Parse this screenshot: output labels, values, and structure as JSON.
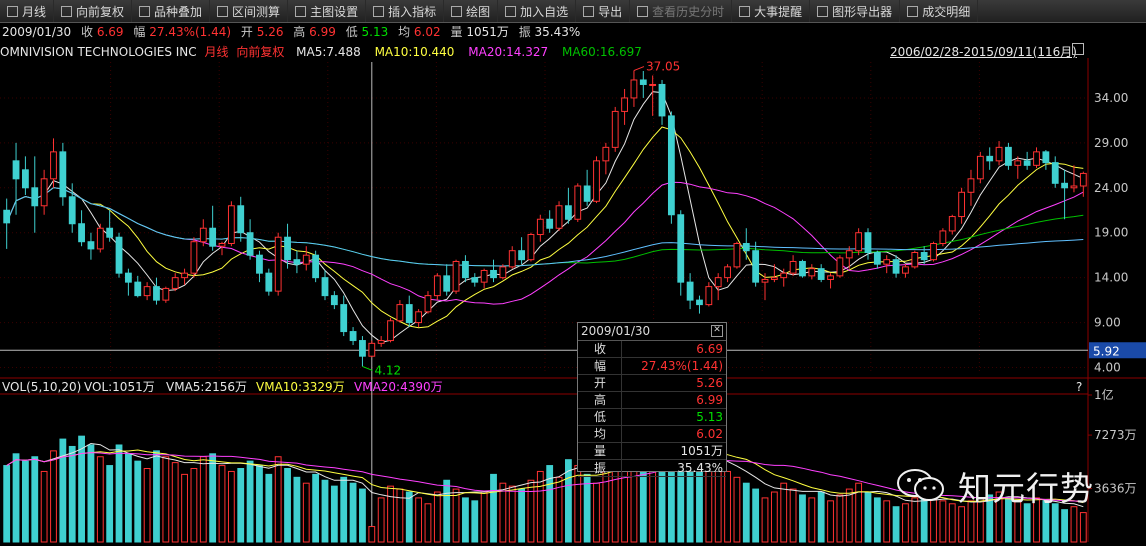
{
  "toolbar": [
    {
      "label": "月线",
      "icon": "period-icon",
      "enabled": true
    },
    {
      "label": "向前复权",
      "icon": "adjust-icon",
      "enabled": true
    },
    {
      "label": "品种叠加",
      "icon": "overlay-icon",
      "enabled": true
    },
    {
      "label": "区间测算",
      "icon": "range-icon",
      "enabled": true
    },
    {
      "label": "主图设置",
      "icon": "settings-icon",
      "enabled": true
    },
    {
      "label": "插入指标",
      "icon": "indicator-icon",
      "enabled": true
    },
    {
      "label": "绘图",
      "icon": "draw-icon",
      "enabled": true
    },
    {
      "label": "加入自选",
      "icon": "add-icon",
      "enabled": true
    },
    {
      "label": "导出",
      "icon": "export-icon",
      "enabled": true
    },
    {
      "label": "查看历史分时",
      "icon": "history-icon",
      "enabled": false
    },
    {
      "label": "大事提醒",
      "icon": "event-icon",
      "enabled": true
    },
    {
      "label": "图形导出器",
      "icon": "chart-export-icon",
      "enabled": true
    },
    {
      "label": "成交明细",
      "icon": "detail-icon",
      "enabled": true
    }
  ],
  "info": {
    "date": "2009/01/30",
    "close_label": "收",
    "close": "6.69",
    "change_label": "幅",
    "change": "27.43%(1.44)",
    "open_label": "开",
    "open": "5.26",
    "high_label": "高",
    "high": "6.99",
    "low_label": "低",
    "low": "5.13",
    "avg_label": "均",
    "avg": "6.02",
    "vol_label": "量",
    "vol": "1051万",
    "amp_label": "振",
    "amp": "35.43%"
  },
  "title": {
    "name": "OMNIVISION TECHNOLOGIES INC",
    "period": "月线",
    "adjust": "向前复权",
    "ma5": "MA5:7.488",
    "ma10": "MA10:10.440",
    "ma20": "MA20:14.327",
    "ma60": "MA60:16.697",
    "range": "2006/02/28-2015/09/11(116月)"
  },
  "price_axis": {
    "ticks": [
      "34.00",
      "29.00",
      "24.00",
      "19.00",
      "14.00",
      "9.00",
      "4.00"
    ],
    "crosshair": "5.92"
  },
  "annotations": {
    "high": "37.05",
    "low": "4.12"
  },
  "volume_title": {
    "name": "VOL(5,10,20)",
    "vol": "VOL:1051万",
    "vma5": "VMA5:2156万",
    "vma10": "VMA10:3329万",
    "vma20": "VMA20:4390万",
    "help": "?"
  },
  "volume_axis": {
    "top": "1亿",
    "mid": "7273万",
    "low": "3636万"
  },
  "popup": {
    "date": "2009/01/30",
    "close_btn": "✕",
    "rows": [
      {
        "k": "收",
        "v": "6.69",
        "c": "#ff3232"
      },
      {
        "k": "幅",
        "v": "27.43%(1.44)",
        "c": "#ff3232"
      },
      {
        "k": "开",
        "v": "5.26",
        "c": "#ff3232"
      },
      {
        "k": "高",
        "v": "6.99",
        "c": "#ff3232"
      },
      {
        "k": "低",
        "v": "5.13",
        "c": "#00e000"
      },
      {
        "k": "均",
        "v": "6.02",
        "c": "#ff3232"
      },
      {
        "k": "量",
        "v": "1051万",
        "c": "#e6e6e6"
      },
      {
        "k": "振",
        "v": "35.43%",
        "c": "#e6e6e6"
      }
    ]
  },
  "watermark": "知元行势",
  "colors": {
    "up": "#ff3232",
    "down": "#3fd0d0",
    "ma5": "#e6e6e6",
    "ma10": "#ffff40",
    "ma20": "#ff40ff",
    "ma60": "#00c000",
    "ma120": "#60c0ff"
  },
  "chart_data": {
    "type": "candlestick",
    "title": "OMNIVISION TECHNOLOGIES INC 月线",
    "ylim": [
      3.5,
      38
    ],
    "candles": [
      [
        21.5,
        22.8,
        17.2,
        20.1
      ],
      [
        27.0,
        29.0,
        21.0,
        25.0
      ],
      [
        26.0,
        27.5,
        23.2,
        24.0
      ],
      [
        24.0,
        27.5,
        19.0,
        22.0
      ],
      [
        22.0,
        26.0,
        21.0,
        25.0
      ],
      [
        25.0,
        29.5,
        24.0,
        28.0
      ],
      [
        28.0,
        29.0,
        22.0,
        23.0
      ],
      [
        23.0,
        24.5,
        19.0,
        20.0
      ],
      [
        20.0,
        21.5,
        17.5,
        18.0
      ],
      [
        18.0,
        19.0,
        16.0,
        17.2
      ],
      [
        17.2,
        20.0,
        16.8,
        19.5
      ],
      [
        19.5,
        21.5,
        18.0,
        18.5
      ],
      [
        18.5,
        19.0,
        14.0,
        14.5
      ],
      [
        14.5,
        15.0,
        12.0,
        13.5
      ],
      [
        13.5,
        14.2,
        11.8,
        12.0
      ],
      [
        12.0,
        13.5,
        11.5,
        13.0
      ],
      [
        13.0,
        14.0,
        11.0,
        11.5
      ],
      [
        11.5,
        13.0,
        11.2,
        12.8
      ],
      [
        12.8,
        14.5,
        12.5,
        14.0
      ],
      [
        14.0,
        15.0,
        13.2,
        14.5
      ],
      [
        14.5,
        18.5,
        14.0,
        18.0
      ],
      [
        18.0,
        20.5,
        17.5,
        19.5
      ],
      [
        19.5,
        22.0,
        17.0,
        17.5
      ],
      [
        17.5,
        18.0,
        16.5,
        17.8
      ],
      [
        17.8,
        22.5,
        17.5,
        22.0
      ],
      [
        22.0,
        23.0,
        18.0,
        19.0
      ],
      [
        19.0,
        20.5,
        16.0,
        16.5
      ],
      [
        16.5,
        17.0,
        13.5,
        14.5
      ],
      [
        14.5,
        15.0,
        12.0,
        12.5
      ],
      [
        12.5,
        19.0,
        12.0,
        18.5
      ],
      [
        18.5,
        20.0,
        15.0,
        16.0
      ],
      [
        16.0,
        17.0,
        14.5,
        15.5
      ],
      [
        15.5,
        17.5,
        14.8,
        16.5
      ],
      [
        16.5,
        17.0,
        13.5,
        14.0
      ],
      [
        14.0,
        14.8,
        11.5,
        12.0
      ],
      [
        12.0,
        12.5,
        10.5,
        11.0
      ],
      [
        11.0,
        12.0,
        7.5,
        8.0
      ],
      [
        8.0,
        8.5,
        6.5,
        7.0
      ],
      [
        7.0,
        7.5,
        4.12,
        5.26
      ],
      [
        5.26,
        6.99,
        5.13,
        6.69
      ],
      [
        6.69,
        7.5,
        6.3,
        7.0
      ],
      [
        7.0,
        9.5,
        6.8,
        9.2
      ],
      [
        9.2,
        11.5,
        9.0,
        11.0
      ],
      [
        11.0,
        12.0,
        8.5,
        9.0
      ],
      [
        9.0,
        10.5,
        8.5,
        10.2
      ],
      [
        10.2,
        12.5,
        10.0,
        12.0
      ],
      [
        12.0,
        14.5,
        11.5,
        14.2
      ],
      [
        14.2,
        15.5,
        12.0,
        12.5
      ],
      [
        12.5,
        16.0,
        12.2,
        15.8
      ],
      [
        15.8,
        16.5,
        13.5,
        14.0
      ],
      [
        14.0,
        14.5,
        13.0,
        13.5
      ],
      [
        13.5,
        15.0,
        12.8,
        14.8
      ],
      [
        14.8,
        16.0,
        13.5,
        14.0
      ],
      [
        14.0,
        15.5,
        13.8,
        15.2
      ],
      [
        15.2,
        17.5,
        15.0,
        17.0
      ],
      [
        17.0,
        18.5,
        15.5,
        16.0
      ],
      [
        16.0,
        19.0,
        15.8,
        18.8
      ],
      [
        18.8,
        21.0,
        18.0,
        20.5
      ],
      [
        20.5,
        21.5,
        19.0,
        19.5
      ],
      [
        19.5,
        22.5,
        19.2,
        22.0
      ],
      [
        22.0,
        24.0,
        20.0,
        20.5
      ],
      [
        20.5,
        24.5,
        20.2,
        24.2
      ],
      [
        24.2,
        26.0,
        22.0,
        22.5
      ],
      [
        22.5,
        27.5,
        22.3,
        27.0
      ],
      [
        27.0,
        29.0,
        25.5,
        28.5
      ],
      [
        28.5,
        33.0,
        28.0,
        32.5
      ],
      [
        32.5,
        35.0,
        31.0,
        34.0
      ],
      [
        34.0,
        37.05,
        33.0,
        36.0
      ],
      [
        36.0,
        37.0,
        34.0,
        35.5
      ],
      [
        35.5,
        36.5,
        32.0,
        35.5
      ],
      [
        35.5,
        36.0,
        31.0,
        32.0
      ],
      [
        32.0,
        32.5,
        20.0,
        21.0
      ],
      [
        21.0,
        21.5,
        12.0,
        13.5
      ],
      [
        13.5,
        14.5,
        10.5,
        11.5
      ],
      [
        11.5,
        12.0,
        10.0,
        11.0
      ],
      [
        11.0,
        13.5,
        10.8,
        13.0
      ],
      [
        13.0,
        14.5,
        11.5,
        14.0
      ],
      [
        14.0,
        15.5,
        13.5,
        15.2
      ],
      [
        15.2,
        18.0,
        15.0,
        17.8
      ],
      [
        17.8,
        19.5,
        16.0,
        17.0
      ],
      [
        17.0,
        18.0,
        13.0,
        13.5
      ],
      [
        13.5,
        14.5,
        11.5,
        13.8
      ],
      [
        13.8,
        15.5,
        13.5,
        14.0
      ],
      [
        14.0,
        15.0,
        13.0,
        14.5
      ],
      [
        14.5,
        16.5,
        14.2,
        15.8
      ],
      [
        15.8,
        16.0,
        14.0,
        14.2
      ],
      [
        14.2,
        15.5,
        13.8,
        15.0
      ],
      [
        15.0,
        15.5,
        13.5,
        13.8
      ],
      [
        13.8,
        14.5,
        12.8,
        14.2
      ],
      [
        14.2,
        16.5,
        14.0,
        16.2
      ],
      [
        16.2,
        17.5,
        15.0,
        17.0
      ],
      [
        17.0,
        19.5,
        16.5,
        19.0
      ],
      [
        19.0,
        19.5,
        16.0,
        16.8
      ],
      [
        16.8,
        17.0,
        15.0,
        15.5
      ],
      [
        15.5,
        16.5,
        14.5,
        16.0
      ],
      [
        16.0,
        16.5,
        14.0,
        14.5
      ],
      [
        14.5,
        15.5,
        14.0,
        15.2
      ],
      [
        15.2,
        17.0,
        15.0,
        16.8
      ],
      [
        16.8,
        17.5,
        15.5,
        16.0
      ],
      [
        16.0,
        18.0,
        15.8,
        17.8
      ],
      [
        17.8,
        19.5,
        17.5,
        19.2
      ],
      [
        19.2,
        21.0,
        18.8,
        20.8
      ],
      [
        20.8,
        24.0,
        20.0,
        23.5
      ],
      [
        23.5,
        26.0,
        22.0,
        25.0
      ],
      [
        25.0,
        28.0,
        24.5,
        27.5
      ],
      [
        27.5,
        28.5,
        26.0,
        27.0
      ],
      [
        27.0,
        29.2,
        26.5,
        28.5
      ],
      [
        28.5,
        29.0,
        26.0,
        26.5
      ],
      [
        26.5,
        27.5,
        25.0,
        27.0
      ],
      [
        27.0,
        28.0,
        26.0,
        26.5
      ],
      [
        26.5,
        28.5,
        26.2,
        28.0
      ],
      [
        28.0,
        28.2,
        26.0,
        26.8
      ],
      [
        26.8,
        27.5,
        24.0,
        24.5
      ],
      [
        24.5,
        26.0,
        20.5,
        24.0
      ],
      [
        24.0,
        26.5,
        23.5,
        24.2
      ],
      [
        24.2,
        25.8,
        23.0,
        25.6
      ]
    ],
    "volumes": [
      52,
      60,
      55,
      58,
      48,
      62,
      70,
      65,
      72,
      66,
      58,
      52,
      66,
      60,
      55,
      50,
      62,
      58,
      54,
      46,
      50,
      58,
      60,
      52,
      48,
      50,
      55,
      52,
      46,
      58,
      50,
      44,
      40,
      46,
      42,
      38,
      44,
      40,
      36,
      10.51,
      30,
      38,
      36,
      34,
      30,
      26,
      34,
      42,
      36,
      30,
      28,
      34,
      46,
      40,
      38,
      36,
      42,
      48,
      52,
      44,
      56,
      52,
      46,
      40,
      50,
      56,
      60,
      58,
      62,
      54,
      66,
      70,
      68,
      60,
      58,
      56,
      52,
      48,
      44,
      40,
      36,
      30,
      34,
      40,
      36,
      32,
      30,
      34,
      28,
      32,
      36,
      40,
      34,
      30,
      28,
      24,
      26,
      30,
      32,
      30,
      28,
      26,
      24,
      28,
      30,
      32,
      34,
      30,
      28,
      26,
      30,
      28,
      26,
      22,
      24,
      20
    ]
  }
}
